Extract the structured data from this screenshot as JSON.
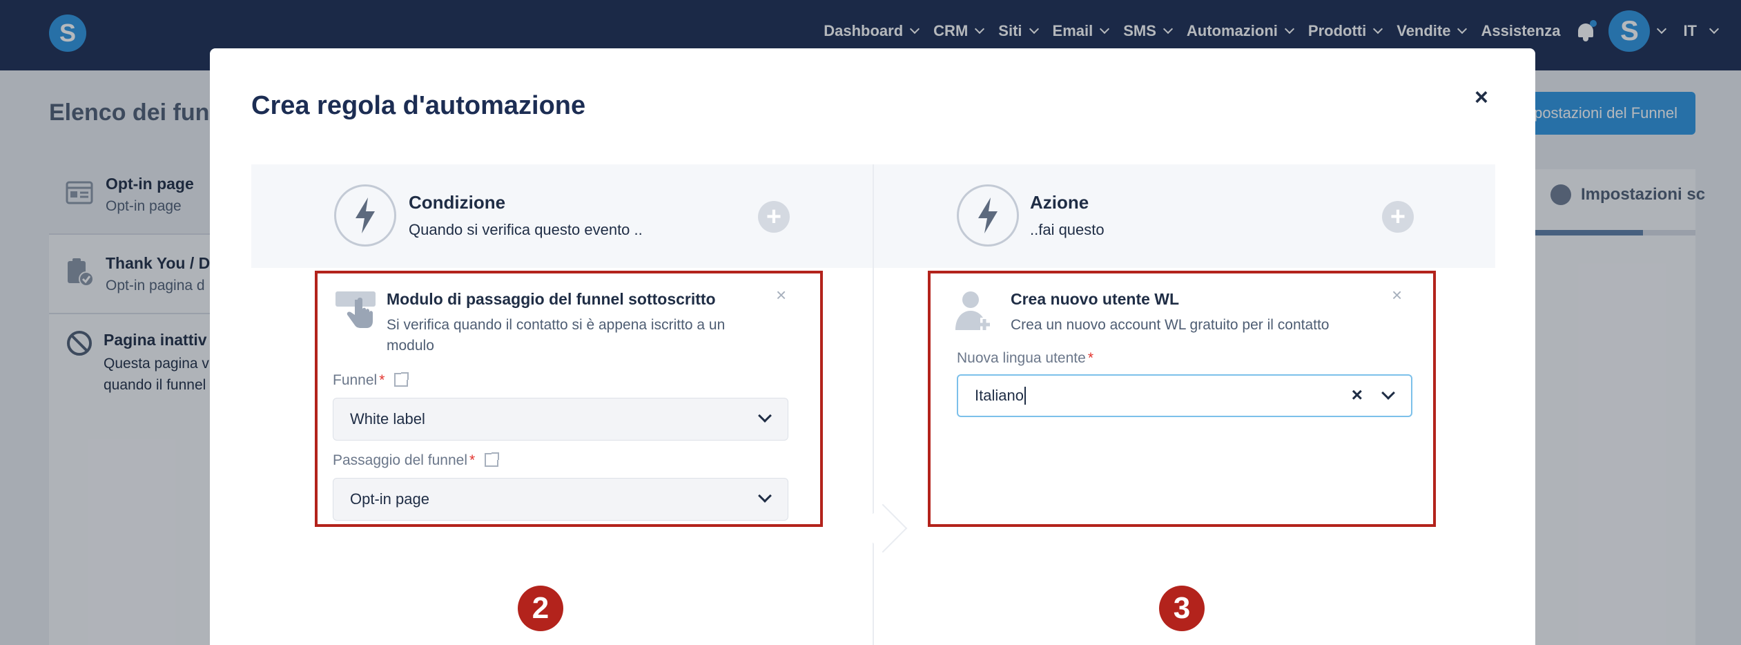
{
  "nav": {
    "items": [
      "Dashboard",
      "CRM",
      "Siti",
      "Email",
      "SMS",
      "Automazioni",
      "Prodotti",
      "Vendite"
    ],
    "help": "Assistenza",
    "avatar_letter": "S",
    "language": "IT",
    "logo_letter": "S"
  },
  "background": {
    "page_title": "Elenco dei funn",
    "settings_button": "postazioni del Funnel",
    "steps": [
      {
        "title": "Opt-in page",
        "subtitle": "Opt-in page"
      },
      {
        "title": "Thank You / D",
        "subtitle": "Opt-in pagina d"
      },
      {
        "title": "Pagina inattiv",
        "subtitle_lines": [
          "Questa pagina v",
          "quando il funnel"
        ]
      }
    ],
    "settings_tab": "Impostazioni sc",
    "progress_fraction": 0.68
  },
  "modal": {
    "title": "Crea regola d'automazione",
    "close_glyph": "×",
    "condition": {
      "title": "Condizione",
      "subtitle": "Quando si verifica questo evento ..",
      "add_glyph": "+"
    },
    "action": {
      "title": "Azione",
      "subtitle": "..fai questo",
      "add_glyph": "+"
    },
    "trigger_card": {
      "title": "Modulo di passaggio del funnel sottoscritto",
      "description": "Si verifica quando il contatto si è appena iscritto a un modulo",
      "close_glyph": "×",
      "funnel_label": "Funnel",
      "funnel_value": "White label",
      "step_label": "Passaggio del funnel",
      "step_value": "Opt-in page",
      "required_mark": "*"
    },
    "action_card": {
      "title": "Crea nuovo utente WL",
      "description": "Crea un nuovo account WL gratuito per il contatto",
      "close_glyph": "×",
      "language_label": "Nuova lingua utente",
      "language_value": "Italiano",
      "required_mark": "*",
      "clear_glyph": "×"
    }
  },
  "annotations": {
    "badge_left": "2",
    "badge_right": "3"
  },
  "colors": {
    "nav_bg": "#1c2d53",
    "accent": "#2f96e0",
    "highlight_red": "#b3231c",
    "modal_bg": "#ffffff"
  }
}
